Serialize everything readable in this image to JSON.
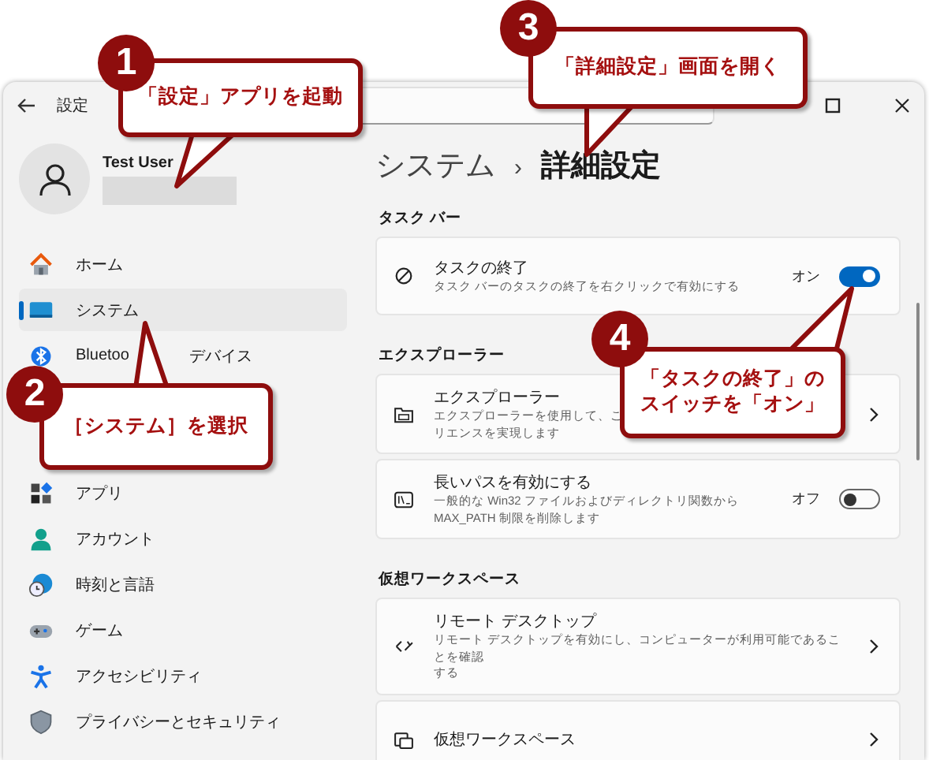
{
  "window": {
    "title": "設定"
  },
  "user": {
    "name": "Test User"
  },
  "nav": [
    {
      "label": "ホーム",
      "selected": false
    },
    {
      "label": "システム",
      "selected": true
    },
    {
      "label": "Bluetoo",
      "label_tail": "デバイス",
      "selected": false
    },
    {
      "label": "アプリ",
      "selected": false
    },
    {
      "label": "アカウント",
      "selected": false
    },
    {
      "label": "時刻と言語",
      "selected": false
    },
    {
      "label": "ゲーム",
      "selected": false
    },
    {
      "label": "アクセシビリティ",
      "selected": false
    },
    {
      "label": "プライバシーとセキュリティ",
      "selected": false
    }
  ],
  "breadcrumb": {
    "parent": "システム",
    "separator": "›",
    "current": "詳細設定"
  },
  "sections": [
    {
      "title": "タスク バー",
      "cards": [
        {
          "title": "タスクの終了",
          "description": [
            "タスク バーのタスクの終了を右クリックで有効にする"
          ],
          "kind": "toggle",
          "on": true,
          "state_label": "オン"
        }
      ]
    },
    {
      "title": "エクスプローラー",
      "cards": [
        {
          "title": "エクスプローラー",
          "description": [
            "エクスプローラーを使用して、こ",
            "リエンスを実現します"
          ],
          "kind": "link"
        },
        {
          "title": "長いパスを有効にする",
          "description": [
            "一般的な Win32 ファイルおよびディレクトリ関数から",
            "MAX_PATH 制限を削除します"
          ],
          "kind": "toggle",
          "on": false,
          "state_label": "オフ"
        }
      ]
    },
    {
      "title": "仮想ワークスペース",
      "cards": [
        {
          "title": "リモート デスクトップ",
          "description": [
            "リモート デスクトップを有効にし、コンピューターが利用可能であることを確認",
            "する"
          ],
          "kind": "link"
        },
        {
          "title": "仮想ワークスペース",
          "kind": "link"
        }
      ]
    }
  ],
  "callouts": [
    {
      "number": "1",
      "lines": [
        "「設定」アプリを起動"
      ]
    },
    {
      "number": "2",
      "lines": [
        "［システム］を選択"
      ]
    },
    {
      "number": "3",
      "lines": [
        "「詳細設定」画面を開く"
      ]
    },
    {
      "number": "4",
      "lines": [
        "「タスクの終了」の",
        "スイッチを「オン」"
      ]
    }
  ]
}
